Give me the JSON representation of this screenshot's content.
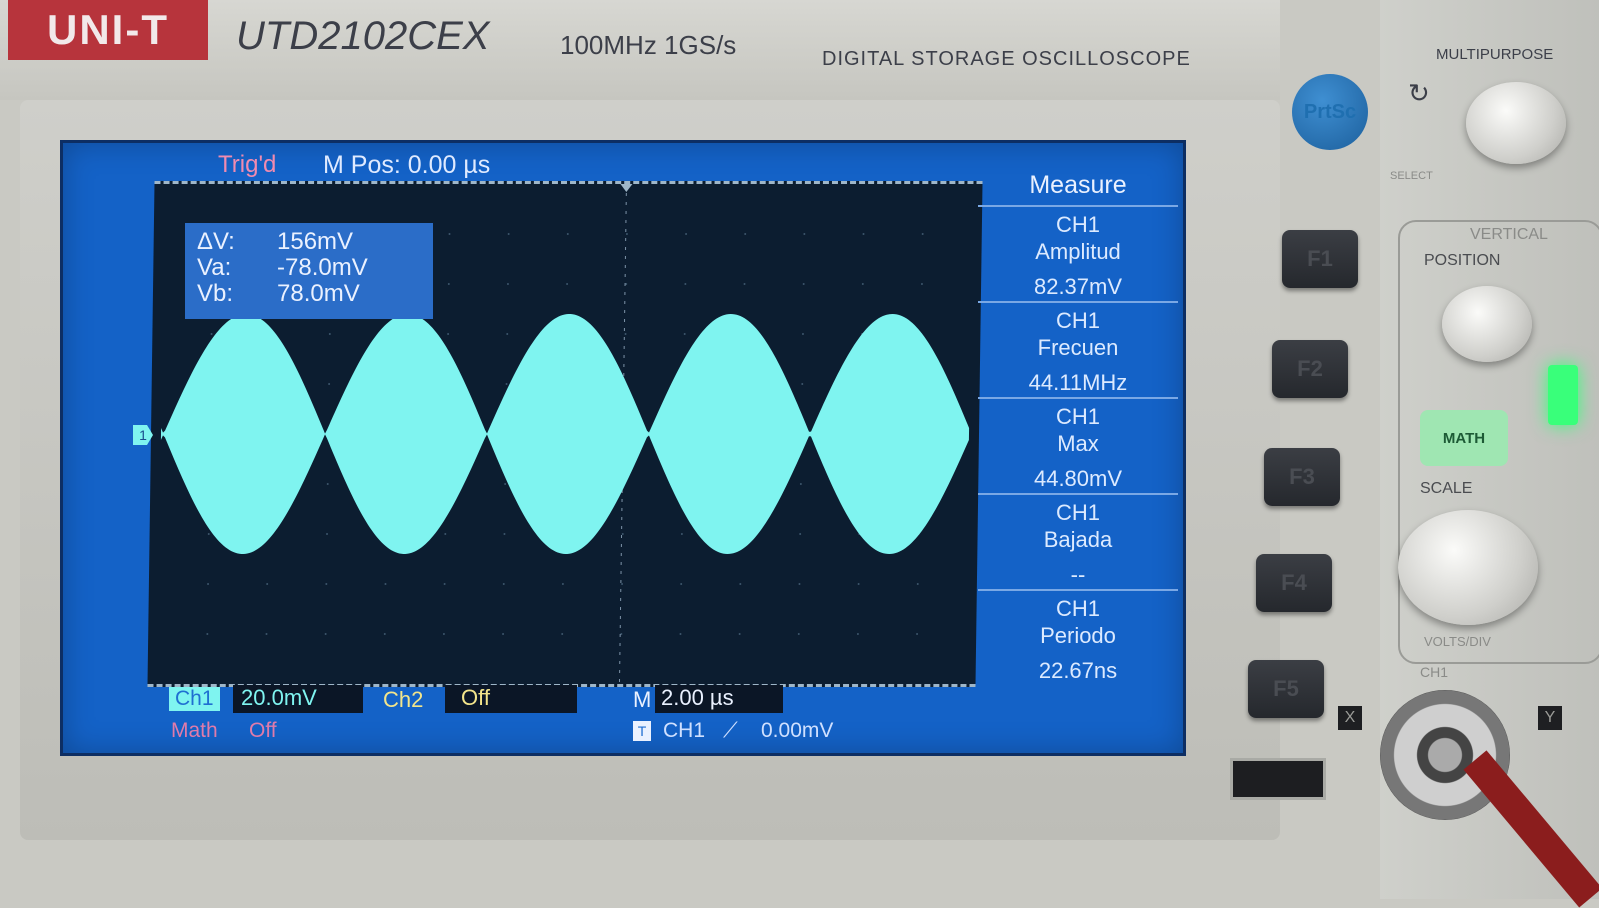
{
  "device": {
    "brand": "UNI-T",
    "model": "UTD2102CEX",
    "specs": "100MHz  1GS/s",
    "description": "DIGITAL STORAGE OSCILLOSCOPE"
  },
  "screen": {
    "trigger_status": "Trig'd",
    "m_pos": "M Pos: 0.00 µs",
    "channel_marker": "1",
    "cursors": [
      {
        "label": "ΔV:",
        "value": "156mV"
      },
      {
        "label": "Va:",
        "value": "-78.0mV"
      },
      {
        "label": "Vb:",
        "value": "78.0mV"
      }
    ],
    "measure": {
      "title": "Measure",
      "items": [
        {
          "source": "CH1",
          "name": "Amplitud",
          "value": "82.37mV"
        },
        {
          "source": "CH1",
          "name": "Frecuen",
          "value": "44.11MHz"
        },
        {
          "source": "CH1",
          "name": "Max",
          "value": "44.80mV"
        },
        {
          "source": "CH1",
          "name": "Bajada",
          "value": "--"
        },
        {
          "source": "CH1",
          "name": "Periodo",
          "value": "22.67ns"
        }
      ]
    },
    "bottom": {
      "ch1_label": "Ch1",
      "ch1_scale": "20.0mV",
      "ch2_label": "Ch2",
      "ch2_scale": "Off",
      "timebase_label": "M",
      "timebase": "2.00 µs",
      "math_label": "Math",
      "math_state": "Off",
      "trigger_icon": "T",
      "trigger_source": "CH1",
      "trigger_edge": "rising-edge-icon",
      "trigger_level": "0.00mV"
    },
    "waveform": {
      "color": "#7ff4f0",
      "type": "amplitude-modulated",
      "lobes": 5
    }
  },
  "controls": {
    "prtsc": "PrtSc",
    "f_buttons": [
      "F1",
      "F2",
      "F3",
      "F4",
      "F5"
    ],
    "multipurpose": "MULTIPURPOSE",
    "select": "SELECT",
    "vertical": "VERTICAL",
    "position": "POSITION",
    "math": "MATH",
    "scale": "SCALE",
    "volts_div": "VOLTS/DIV",
    "ch1": "CH1",
    "x": "X",
    "y": "Y"
  },
  "colors": {
    "screen_bg": "#1462c7",
    "grid_bg": "#0c1d30",
    "trace": "#7ff4f0",
    "logo_red": "#b7343c"
  }
}
